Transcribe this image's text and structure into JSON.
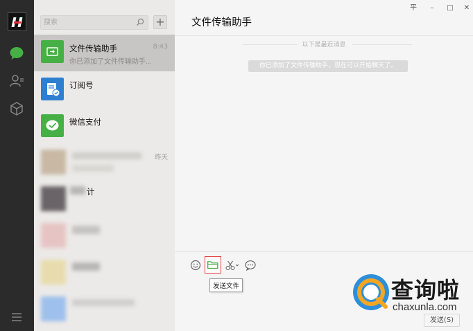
{
  "search": {
    "placeholder": "搜索"
  },
  "add_button": "+",
  "chats": [
    {
      "name": "文件传输助手",
      "preview": "你已添加了文件传输助手...",
      "time": "8:43",
      "active": true
    },
    {
      "name": "订阅号",
      "preview": "",
      "time": ""
    },
    {
      "name": "微信支付",
      "preview": "",
      "time": ""
    },
    {
      "name": "",
      "preview": "",
      "time": "昨天"
    },
    {
      "name": "计",
      "preview": "",
      "time": ""
    }
  ],
  "main": {
    "title": "文件传输助手",
    "divider": "以下是最近消息",
    "system_message": "你已添加了文件传输助手，现在可以开始聊天了。"
  },
  "window": {
    "pin": "平",
    "minimize": "–",
    "maximize": "□",
    "close": "✕"
  },
  "toolbar": {
    "tooltip": "发送文件"
  },
  "send_button": "发送(S)",
  "watermark": {
    "cn": "查询啦",
    "en": "chaxunla.com"
  },
  "colors": {
    "accent_green": "#46b046",
    "nav_bg": "#2b2b2b",
    "list_bg": "#eceae8",
    "active_item": "#c8c6c5"
  }
}
